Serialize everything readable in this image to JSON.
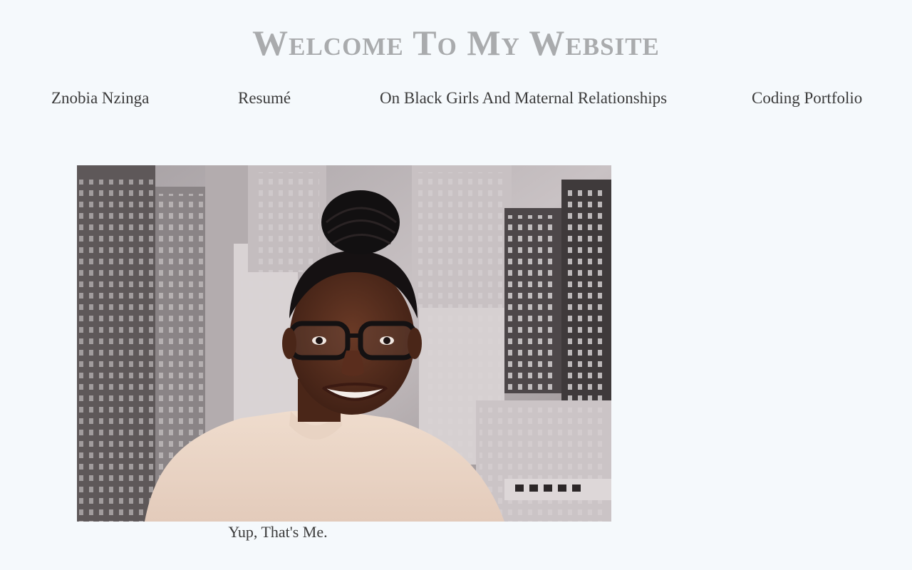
{
  "header": {
    "title": "Welcome To My Website"
  },
  "nav": {
    "items": [
      {
        "label": "Znobia Nzinga"
      },
      {
        "label": "Resumé"
      },
      {
        "label": "On Black Girls And Maternal Relationships"
      },
      {
        "label": "Coding Portfolio"
      }
    ]
  },
  "main": {
    "photo": {
      "subject": "portrait of woman with glasses in front of city skyline mural"
    },
    "caption": "Yup, That's Me."
  },
  "colors": {
    "background": "#f5f9fc",
    "title": "#a9abad",
    "text": "#3a3a3a"
  }
}
